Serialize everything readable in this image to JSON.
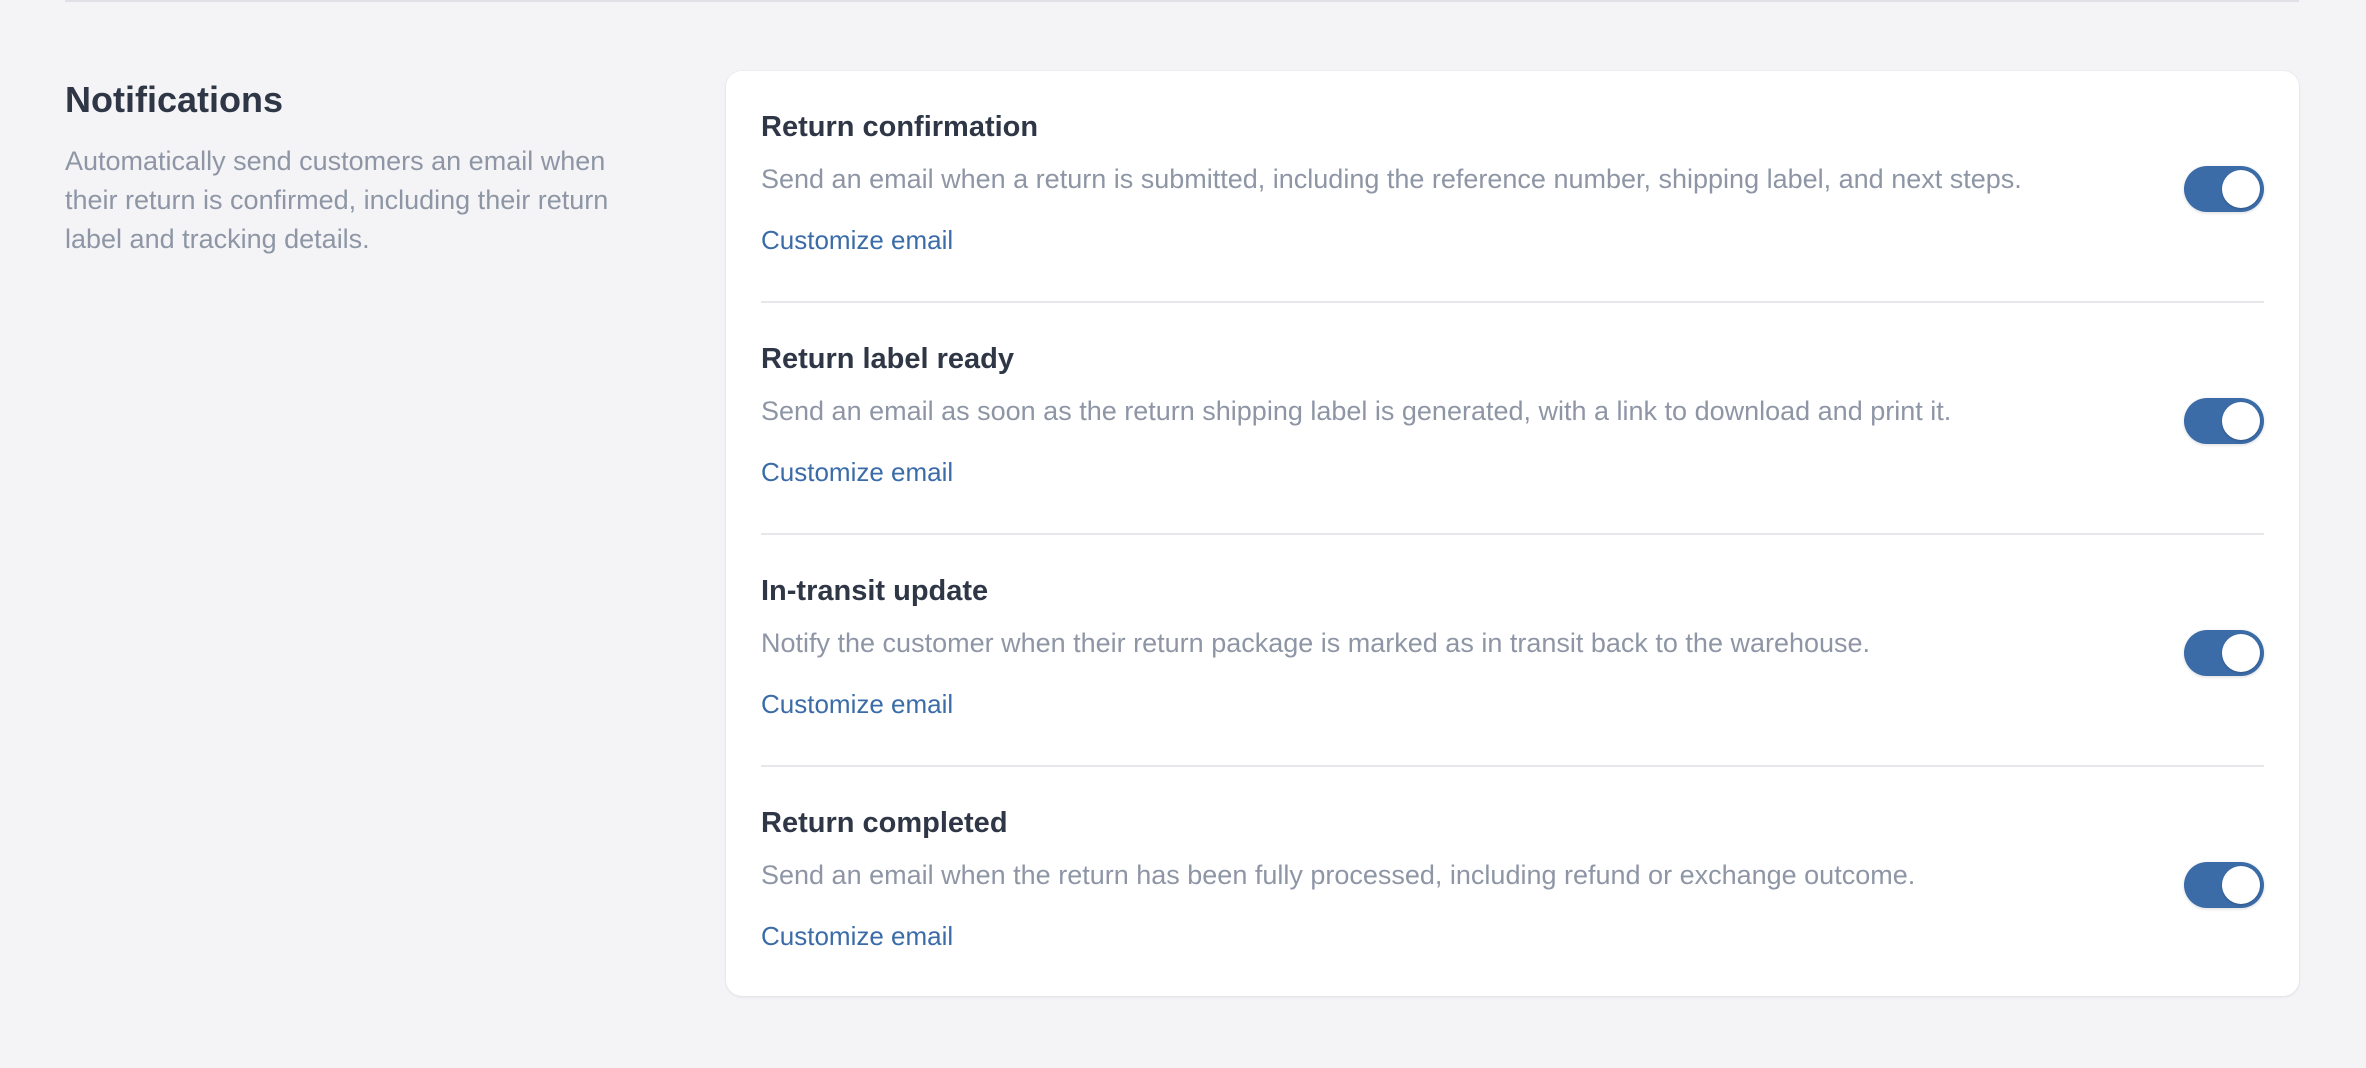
{
  "section": {
    "title": "Notifications",
    "description": "Automatically send customers an email when their return is confirmed, including their return label and tracking details."
  },
  "notifications": [
    {
      "title": "Return confirmation",
      "description": "Send an email when a return is submitted, including the reference number, shipping label, and next steps.",
      "link_label": "Customize email",
      "enabled": true
    },
    {
      "title": "Return label ready",
      "description": "Send an email as soon as the return shipping label is generated, with a link to download and print it.",
      "link_label": "Customize email",
      "enabled": true
    },
    {
      "title": "In-transit update",
      "description": "Notify the customer when their return package is marked as in transit back to the warehouse.",
      "link_label": "Customize email",
      "enabled": true
    },
    {
      "title": "Return completed",
      "description": "Send an email when the return has been fully processed, including refund or exchange outcome.",
      "link_label": "Customize email",
      "enabled": true
    }
  ],
  "colors": {
    "accent": "#3b6ca8",
    "background": "#f4f4f6",
    "card": "#ffffff",
    "title_text": "#2f3746",
    "muted_text": "#8e96a6"
  }
}
